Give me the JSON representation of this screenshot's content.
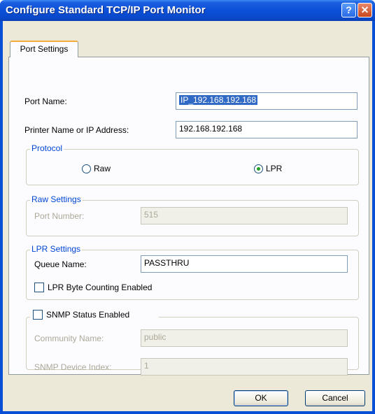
{
  "window": {
    "title": "Configure Standard TCP/IP Port Monitor",
    "help_glyph": "?",
    "close_glyph": "✕"
  },
  "tabs": [
    {
      "label": "Port Settings"
    }
  ],
  "port_name": {
    "label": "Port Name:",
    "value": "IP_192.168.192.168"
  },
  "printer_name": {
    "label": "Printer Name or IP Address:",
    "value": "192.168.192.168"
  },
  "protocol": {
    "title": "Protocol",
    "options": [
      {
        "label": "Raw",
        "selected": false
      },
      {
        "label": "LPR",
        "selected": true
      }
    ]
  },
  "raw_settings": {
    "title": "Raw Settings",
    "port_number_label": "Port Number:",
    "port_number_value": "515"
  },
  "lpr_settings": {
    "title": "LPR Settings",
    "queue_label": "Queue Name:",
    "queue_value": "PASSTHRU",
    "byte_counting_label": "LPR Byte Counting Enabled",
    "byte_counting_checked": false
  },
  "snmp": {
    "title": "SNMP Status Enabled",
    "checked": false,
    "community_label": "Community Name:",
    "community_value": "public",
    "device_index_label": "SNMP Device Index:",
    "device_index_value": "1"
  },
  "buttons": {
    "ok": "OK",
    "cancel": "Cancel"
  },
  "colors": {
    "titlebar": "#0a50d6",
    "dialog_bg": "#ece9d8",
    "group_title": "#0046d5"
  }
}
